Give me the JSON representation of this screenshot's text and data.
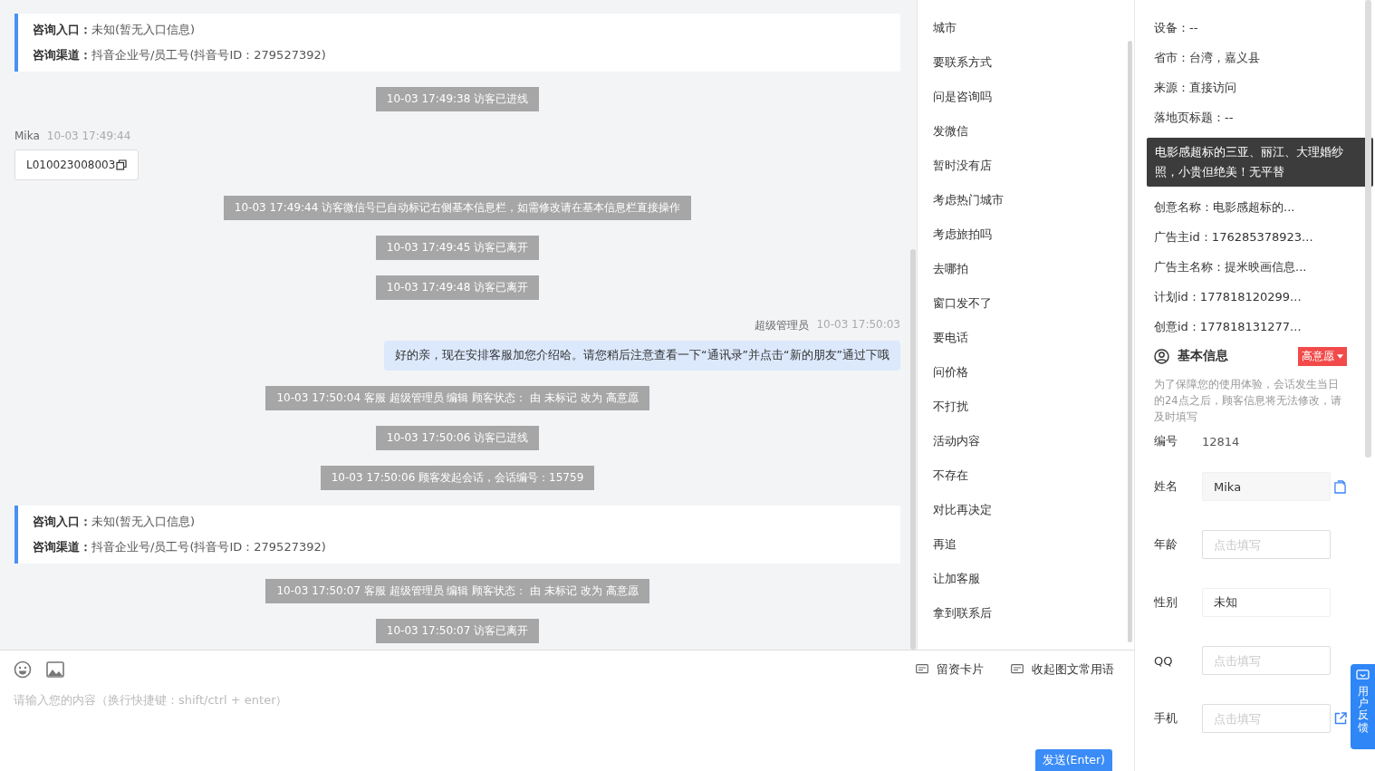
{
  "messages": [
    {
      "kind": "info-card",
      "entry_label": "咨询入口：",
      "entry_value": "未知(暂无入口信息)",
      "channel_label": "咨询渠道：",
      "channel_value": "抖音企业号/员工号(抖音号ID：279527392)"
    },
    {
      "kind": "system",
      "text": "10-03 17:49:38 访客已进线"
    },
    {
      "kind": "visitor",
      "sender": "Mika",
      "time": "10-03 17:49:44",
      "text": "L010023008003"
    },
    {
      "kind": "system",
      "text": "10-03 17:49:44 访客微信号已自动标记右侧基本信息栏，如需修改请在基本信息栏直接操作"
    },
    {
      "kind": "system",
      "text": "10-03 17:49:45 访客已离开"
    },
    {
      "kind": "system",
      "text": "10-03 17:49:48 访客已离开"
    },
    {
      "kind": "agent",
      "sender": "超级管理员",
      "time": "10-03 17:50:03",
      "text": "好的亲，现在安排客服加您介绍哈。请您稍后注意查看一下“通讯录”并点击“新的朋友”通过下哦"
    },
    {
      "kind": "system",
      "text": "10-03 17:50:04 客服 超级管理员 编辑 顾客状态： 由 未标记 改为 高意愿"
    },
    {
      "kind": "system",
      "text": "10-03 17:50:06 访客已进线"
    },
    {
      "kind": "system",
      "text": "10-03 17:50:06 顾客发起会话，会话编号：15759"
    },
    {
      "kind": "info-card",
      "entry_label": "咨询入口：",
      "entry_value": "未知(暂无入口信息)",
      "channel_label": "咨询渠道：",
      "channel_value": "抖音企业号/员工号(抖音号ID：279527392)"
    },
    {
      "kind": "system",
      "text": "10-03 17:50:07 客服 超级管理员 编辑 顾客状态： 由 未标记 改为 高意愿"
    },
    {
      "kind": "system",
      "text": "10-03 17:50:07 访客已离开"
    }
  ],
  "quick_phrases": [
    "城市",
    "要联系方式",
    "问是咨询吗",
    "发微信",
    "暂时没有店",
    "考虑热门城市",
    "考虑旅拍吗",
    "去哪拍",
    "窗口发不了",
    "要电话",
    "问价格",
    "不打扰",
    "活动内容",
    "不存在",
    "对比再决定",
    "再追",
    "让加客服",
    "拿到联系后"
  ],
  "composer": {
    "placeholder": "请输入您的内容（换行快捷键：shift/ctrl + enter）",
    "actions": [
      "留资卡片",
      "收起图文常用语"
    ],
    "send_button": "发送(Enter)"
  },
  "visitor_info": [
    "设备：--",
    "省市：台湾，嘉义县",
    "来源：直接访问",
    "落地页标题：--",
    "创意名称：电影感超标的...",
    "广告主id：176285378923...",
    "广告主名称：提米映画信息...",
    "计划id：177818120299...",
    "创意id：177818131277..."
  ],
  "tooltip": "电影感超标的三亚、丽江、大理婚纱照，小贵但绝美！无平替",
  "basic_info": {
    "title": "基本信息",
    "intent_tag": "高意愿",
    "notice": "为了保障您的使用体验，会话发生当日的24点之后，顾客信息将无法修改，请及时填写",
    "fields": [
      {
        "kind": "text",
        "label": "编号",
        "value": "12814"
      },
      {
        "kind": "readonly",
        "label": "姓名",
        "value": "Mika"
      },
      {
        "kind": "input",
        "label": "年龄",
        "placeholder": "点击填写"
      },
      {
        "kind": "select",
        "label": "性别",
        "value": "未知"
      },
      {
        "kind": "input",
        "label": "QQ",
        "placeholder": "点击填写"
      },
      {
        "kind": "input-link",
        "label": "手机",
        "placeholder": "点击填写"
      }
    ]
  },
  "feedback_button": "用户反馈"
}
